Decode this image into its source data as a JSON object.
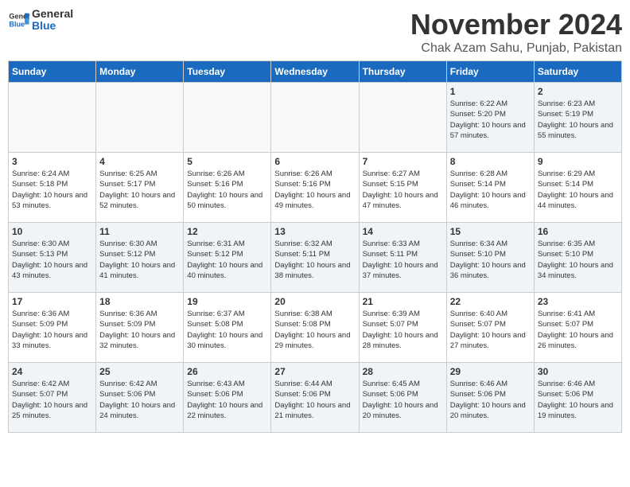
{
  "logo": {
    "line1": "General",
    "line2": "Blue"
  },
  "title": "November 2024",
  "subtitle": "Chak Azam Sahu, Punjab, Pakistan",
  "weekdays": [
    "Sunday",
    "Monday",
    "Tuesday",
    "Wednesday",
    "Thursday",
    "Friday",
    "Saturday"
  ],
  "weeks": [
    [
      {
        "day": "",
        "text": ""
      },
      {
        "day": "",
        "text": ""
      },
      {
        "day": "",
        "text": ""
      },
      {
        "day": "",
        "text": ""
      },
      {
        "day": "",
        "text": ""
      },
      {
        "day": "1",
        "text": "Sunrise: 6:22 AM\nSunset: 5:20 PM\nDaylight: 10 hours and 57 minutes."
      },
      {
        "day": "2",
        "text": "Sunrise: 6:23 AM\nSunset: 5:19 PM\nDaylight: 10 hours and 55 minutes."
      }
    ],
    [
      {
        "day": "3",
        "text": "Sunrise: 6:24 AM\nSunset: 5:18 PM\nDaylight: 10 hours and 53 minutes."
      },
      {
        "day": "4",
        "text": "Sunrise: 6:25 AM\nSunset: 5:17 PM\nDaylight: 10 hours and 52 minutes."
      },
      {
        "day": "5",
        "text": "Sunrise: 6:26 AM\nSunset: 5:16 PM\nDaylight: 10 hours and 50 minutes."
      },
      {
        "day": "6",
        "text": "Sunrise: 6:26 AM\nSunset: 5:16 PM\nDaylight: 10 hours and 49 minutes."
      },
      {
        "day": "7",
        "text": "Sunrise: 6:27 AM\nSunset: 5:15 PM\nDaylight: 10 hours and 47 minutes."
      },
      {
        "day": "8",
        "text": "Sunrise: 6:28 AM\nSunset: 5:14 PM\nDaylight: 10 hours and 46 minutes."
      },
      {
        "day": "9",
        "text": "Sunrise: 6:29 AM\nSunset: 5:14 PM\nDaylight: 10 hours and 44 minutes."
      }
    ],
    [
      {
        "day": "10",
        "text": "Sunrise: 6:30 AM\nSunset: 5:13 PM\nDaylight: 10 hours and 43 minutes."
      },
      {
        "day": "11",
        "text": "Sunrise: 6:30 AM\nSunset: 5:12 PM\nDaylight: 10 hours and 41 minutes."
      },
      {
        "day": "12",
        "text": "Sunrise: 6:31 AM\nSunset: 5:12 PM\nDaylight: 10 hours and 40 minutes."
      },
      {
        "day": "13",
        "text": "Sunrise: 6:32 AM\nSunset: 5:11 PM\nDaylight: 10 hours and 38 minutes."
      },
      {
        "day": "14",
        "text": "Sunrise: 6:33 AM\nSunset: 5:11 PM\nDaylight: 10 hours and 37 minutes."
      },
      {
        "day": "15",
        "text": "Sunrise: 6:34 AM\nSunset: 5:10 PM\nDaylight: 10 hours and 36 minutes."
      },
      {
        "day": "16",
        "text": "Sunrise: 6:35 AM\nSunset: 5:10 PM\nDaylight: 10 hours and 34 minutes."
      }
    ],
    [
      {
        "day": "17",
        "text": "Sunrise: 6:36 AM\nSunset: 5:09 PM\nDaylight: 10 hours and 33 minutes."
      },
      {
        "day": "18",
        "text": "Sunrise: 6:36 AM\nSunset: 5:09 PM\nDaylight: 10 hours and 32 minutes."
      },
      {
        "day": "19",
        "text": "Sunrise: 6:37 AM\nSunset: 5:08 PM\nDaylight: 10 hours and 30 minutes."
      },
      {
        "day": "20",
        "text": "Sunrise: 6:38 AM\nSunset: 5:08 PM\nDaylight: 10 hours and 29 minutes."
      },
      {
        "day": "21",
        "text": "Sunrise: 6:39 AM\nSunset: 5:07 PM\nDaylight: 10 hours and 28 minutes."
      },
      {
        "day": "22",
        "text": "Sunrise: 6:40 AM\nSunset: 5:07 PM\nDaylight: 10 hours and 27 minutes."
      },
      {
        "day": "23",
        "text": "Sunrise: 6:41 AM\nSunset: 5:07 PM\nDaylight: 10 hours and 26 minutes."
      }
    ],
    [
      {
        "day": "24",
        "text": "Sunrise: 6:42 AM\nSunset: 5:07 PM\nDaylight: 10 hours and 25 minutes."
      },
      {
        "day": "25",
        "text": "Sunrise: 6:42 AM\nSunset: 5:06 PM\nDaylight: 10 hours and 24 minutes."
      },
      {
        "day": "26",
        "text": "Sunrise: 6:43 AM\nSunset: 5:06 PM\nDaylight: 10 hours and 22 minutes."
      },
      {
        "day": "27",
        "text": "Sunrise: 6:44 AM\nSunset: 5:06 PM\nDaylight: 10 hours and 21 minutes."
      },
      {
        "day": "28",
        "text": "Sunrise: 6:45 AM\nSunset: 5:06 PM\nDaylight: 10 hours and 20 minutes."
      },
      {
        "day": "29",
        "text": "Sunrise: 6:46 AM\nSunset: 5:06 PM\nDaylight: 10 hours and 20 minutes."
      },
      {
        "day": "30",
        "text": "Sunrise: 6:46 AM\nSunset: 5:06 PM\nDaylight: 10 hours and 19 minutes."
      }
    ]
  ]
}
